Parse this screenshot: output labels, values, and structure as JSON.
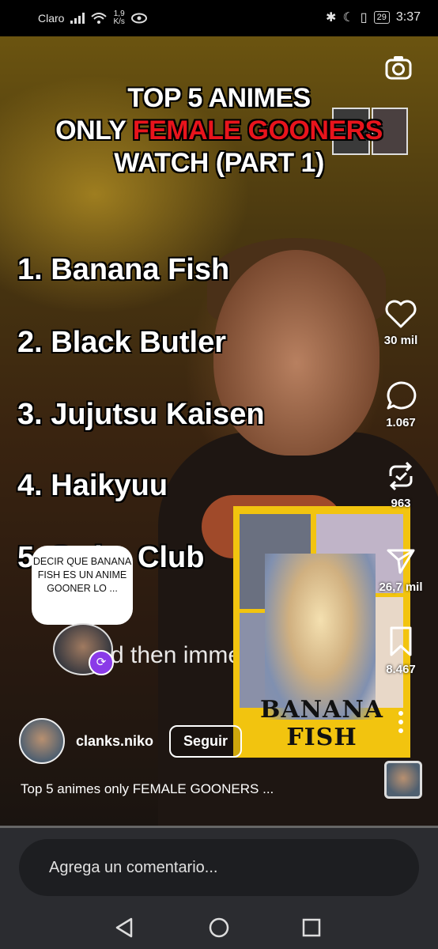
{
  "status_bar": {
    "carrier": "Claro",
    "speed_top": "1,9",
    "speed_bottom": "K/s",
    "battery": "29",
    "time": "3:37"
  },
  "video": {
    "title_line1": "TOP 5 ANIMES",
    "title_line2_white": "ONLY ",
    "title_line2_red": "FEMALE GOONERS",
    "title_line3": "WATCH (PART 1)",
    "list": [
      "1. Banana Fish",
      "2. Black Butler",
      "3. Jujutsu Kaisen",
      "4. Haikyuu",
      "5. Swim Club"
    ],
    "subtitle": "d then immediately",
    "bubble_text": "DECIR QUE BANANA FISH ES UN ANIME GOONER LO ...",
    "poster_title": "BANANA FISH"
  },
  "actions": {
    "likes": "30 mil",
    "comments": "1.067",
    "reposts": "963",
    "shares": "26,7 mil",
    "saves": "8.467"
  },
  "author": {
    "username": "clanks.niko",
    "follow_label": "Seguir"
  },
  "caption": "Top 5 animes only FEMALE GOONERS ...",
  "comment_box": {
    "placeholder": "Agrega un comentario..."
  },
  "colors": {
    "accent_red": "#e8141c",
    "repost_purple": "#8a3ae8",
    "poster_yellow": "#f2c40f"
  }
}
